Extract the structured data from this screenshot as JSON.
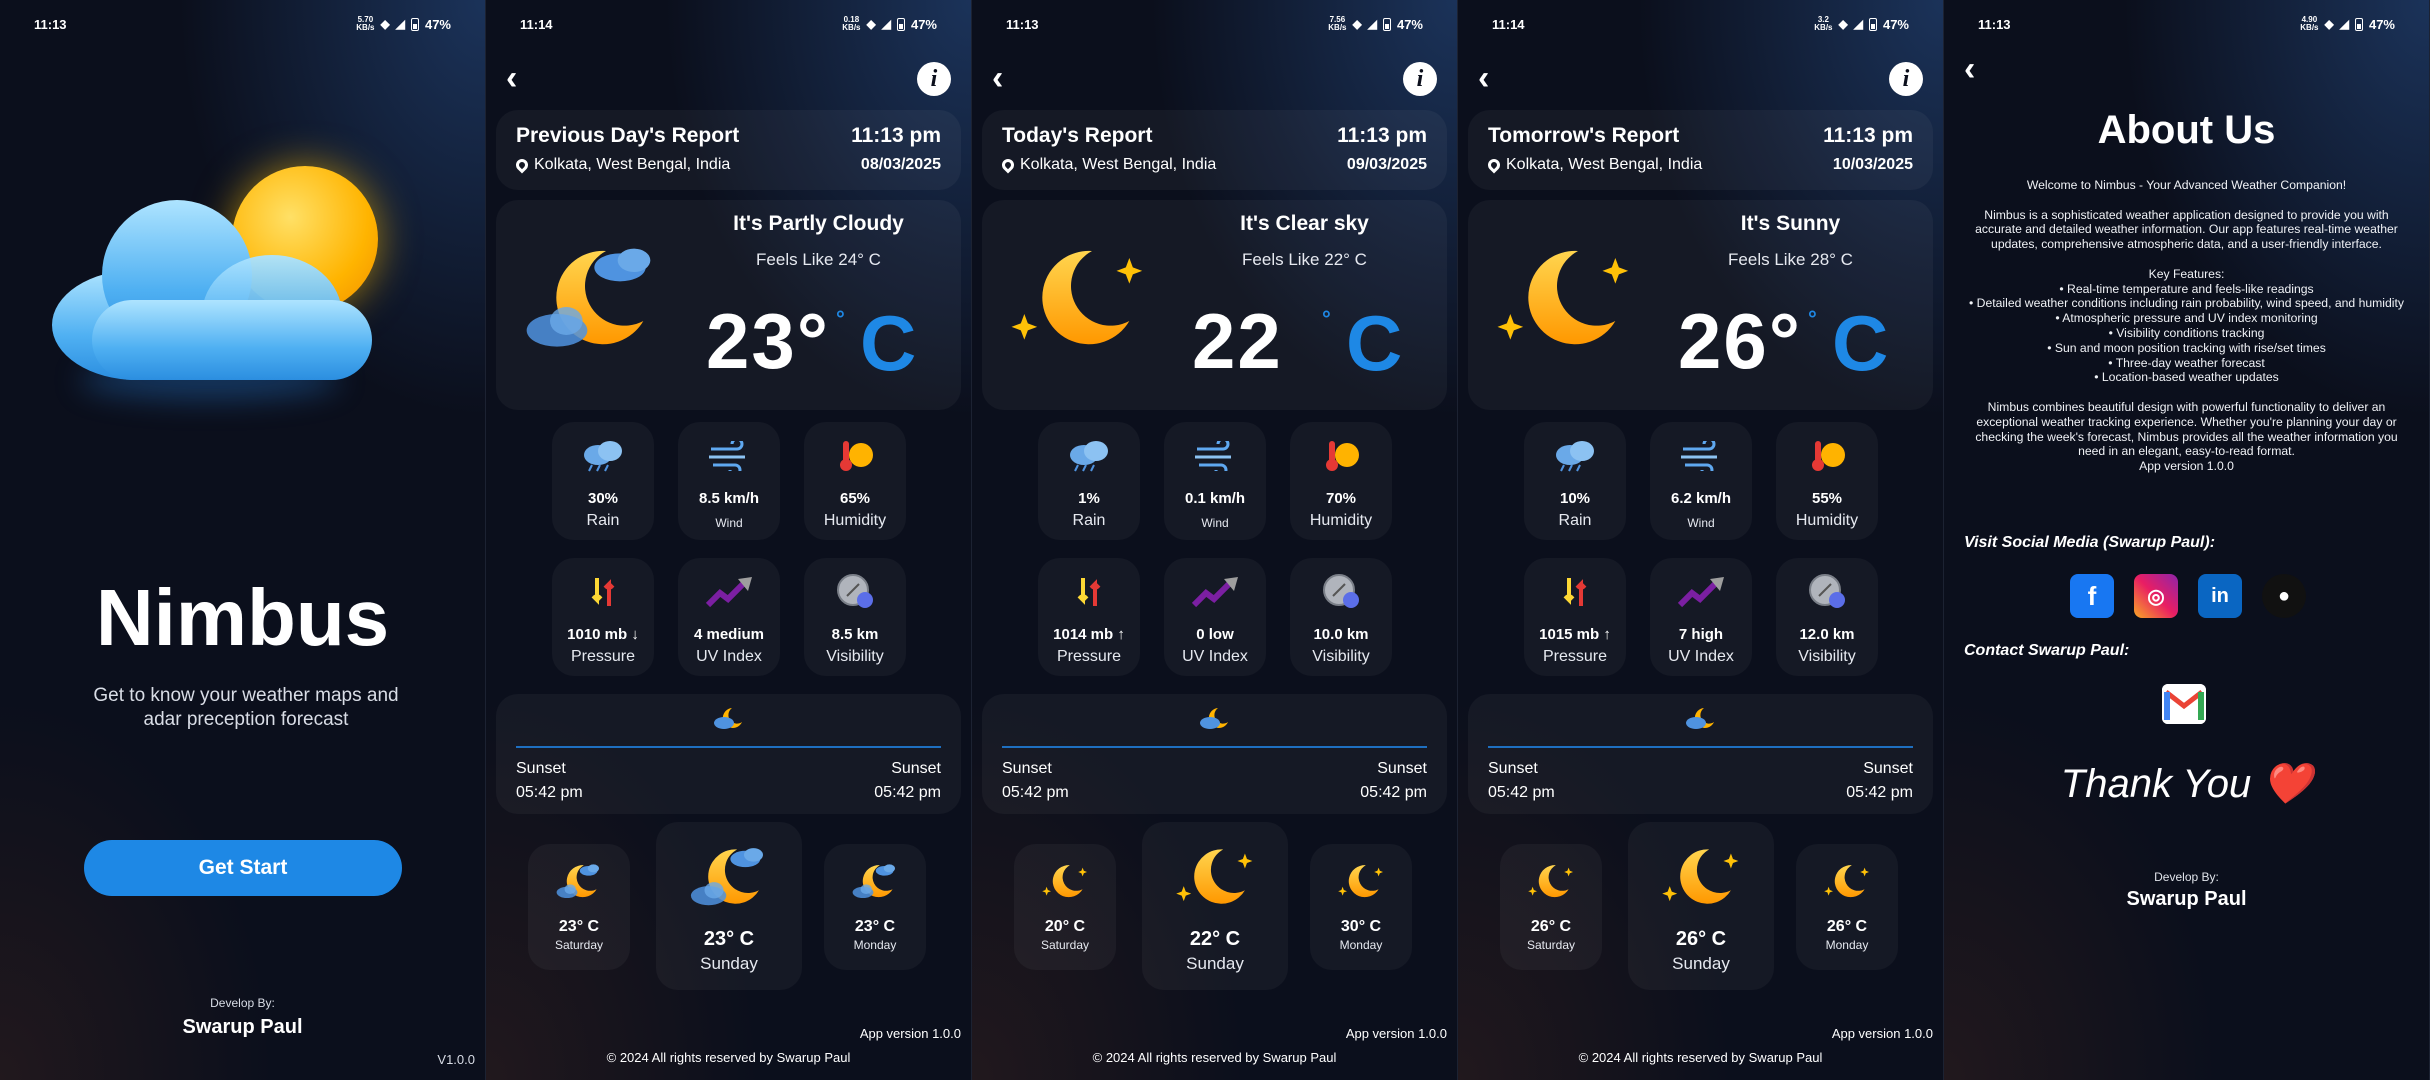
{
  "status": {
    "s1": {
      "time": "11:13",
      "speed": "5.70\nKB/s",
      "battery": "47%"
    },
    "s2": {
      "time": "11:14",
      "speed": "0.18\nKB/s",
      "battery": "47%"
    },
    "s3": {
      "time": "11:13",
      "speed": "7.56\nKB/s",
      "battery": "47%"
    },
    "s4": {
      "time": "11:14",
      "speed": "3.2\nKB/s",
      "battery": "47%"
    },
    "s5": {
      "time": "11:13",
      "speed": "4.90\nKB/s",
      "battery": "47%"
    }
  },
  "splash": {
    "app_name": "Nimbus",
    "tagline": "Get to know your weather maps and adar preception forecast",
    "button": "Get Start",
    "dev_label": "Develop By:",
    "dev_name": "Swarup Paul",
    "version": "V1.0.0"
  },
  "reports": [
    {
      "title": "Previous Day's Report",
      "time": "11:13 pm",
      "location": "Kolkata, West Bengal, India",
      "date": "08/03/2025",
      "condition": "It's Partly Cloudy",
      "feels": "Feels Like 24° C",
      "temp": "23°",
      "unit": "C",
      "deg": "°",
      "rain": "30%",
      "rain_label": "Rain",
      "wind": "8.5 km/h",
      "wind_label": "Wind",
      "humidity": "65%",
      "humidity_label": "Humidity",
      "pressure": "1010 mb ↓",
      "pressure_label": "Pressure",
      "uv": "4 medium",
      "uv_label": "UV Index",
      "visibility": "8.5 km",
      "visibility_label": "Visibility",
      "sunset_l": "Sunset",
      "sunset_l_time": "05:42 pm",
      "sunset_r": "Sunset",
      "sunset_r_time": "05:42 pm",
      "f1_temp": "23° C",
      "f1_day": "Saturday",
      "f2_temp": "23° C",
      "f2_day": "Sunday",
      "f3_temp": "23° C",
      "f3_day": "Monday",
      "icon": "partly-cloudy-night"
    },
    {
      "title": "Today's Report",
      "time": "11:13 pm",
      "location": "Kolkata, West Bengal, India",
      "date": "09/03/2025",
      "condition": "It's Clear sky",
      "feels": "Feels Like 22° C",
      "temp": "22",
      "unit": "C",
      "deg": "°",
      "rain": "1%",
      "rain_label": "Rain",
      "wind": "0.1 km/h",
      "wind_label": "Wind",
      "humidity": "70%",
      "humidity_label": "Humidity",
      "pressure": "1014 mb ↑",
      "pressure_label": "Pressure",
      "uv": "0 low",
      "uv_label": "UV Index",
      "visibility": "10.0 km",
      "visibility_label": "Visibility",
      "sunset_l": "Sunset",
      "sunset_l_time": "05:42 pm",
      "sunset_r": "Sunset",
      "sunset_r_time": "05:42 pm",
      "f1_temp": "20° C",
      "f1_day": "Saturday",
      "f2_temp": "22° C",
      "f2_day": "Sunday",
      "f3_temp": "30° C",
      "f3_day": "Monday",
      "icon": "clear-night"
    },
    {
      "title": "Tomorrow's Report",
      "time": "11:13 pm",
      "location": "Kolkata, West Bengal, India",
      "date": "10/03/2025",
      "condition": "It's Sunny",
      "feels": "Feels Like 28° C",
      "temp": "26°",
      "unit": "C",
      "deg": "°",
      "rain": "10%",
      "rain_label": "Rain",
      "wind": "6.2 km/h",
      "wind_label": "Wind",
      "humidity": "55%",
      "humidity_label": "Humidity",
      "pressure": "1015 mb ↑",
      "pressure_label": "Pressure",
      "uv": "7 high",
      "uv_label": "UV Index",
      "visibility": "12.0 km",
      "visibility_label": "Visibility",
      "sunset_l": "Sunset",
      "sunset_l_time": "05:42 pm",
      "sunset_r": "Sunset",
      "sunset_r_time": "05:42 pm",
      "f1_temp": "26° C",
      "f1_day": "Saturday",
      "f2_temp": "26° C",
      "f2_day": "Sunday",
      "f3_temp": "26° C",
      "f3_day": "Monday",
      "icon": "clear-night"
    }
  ],
  "footer": {
    "app_version": "App version 1.0.0",
    "copyright": "© 2024 All rights reserved by Swarup Paul"
  },
  "about": {
    "title": "About Us",
    "welcome": "Welcome to Nimbus - Your Advanced Weather Companion!",
    "p1": "Nimbus is a sophisticated weather application designed to provide you with accurate and detailed weather information. Our app features real-time weather updates, comprehensive atmospheric data, and a user-friendly interface.",
    "features_title": "Key Features:",
    "f1": "• Real-time temperature and feels-like readings",
    "f2": "• Detailed weather conditions including rain probability, wind speed, and humidity",
    "f3": "• Atmospheric pressure and UV index monitoring",
    "f4": "• Visibility conditions tracking",
    "f5": "• Sun and moon position tracking with rise/set times",
    "f6": "• Three-day weather forecast",
    "f7": "• Location-based weather updates",
    "p2": "Nimbus combines beautiful design with powerful functionality to deliver an exceptional weather tracking experience. Whether you're planning your day or checking the week's forecast, Nimbus provides all the weather information you need in an elegant, easy-to-read format.",
    "version": "App version 1.0.0",
    "social_label": "Visit Social Media (Swarup Paul):",
    "contact_label": "Contact Swarup Paul:",
    "thank": "Thank You ❤️",
    "dev_label": "Develop By:",
    "dev_name": "Swarup Paul"
  }
}
